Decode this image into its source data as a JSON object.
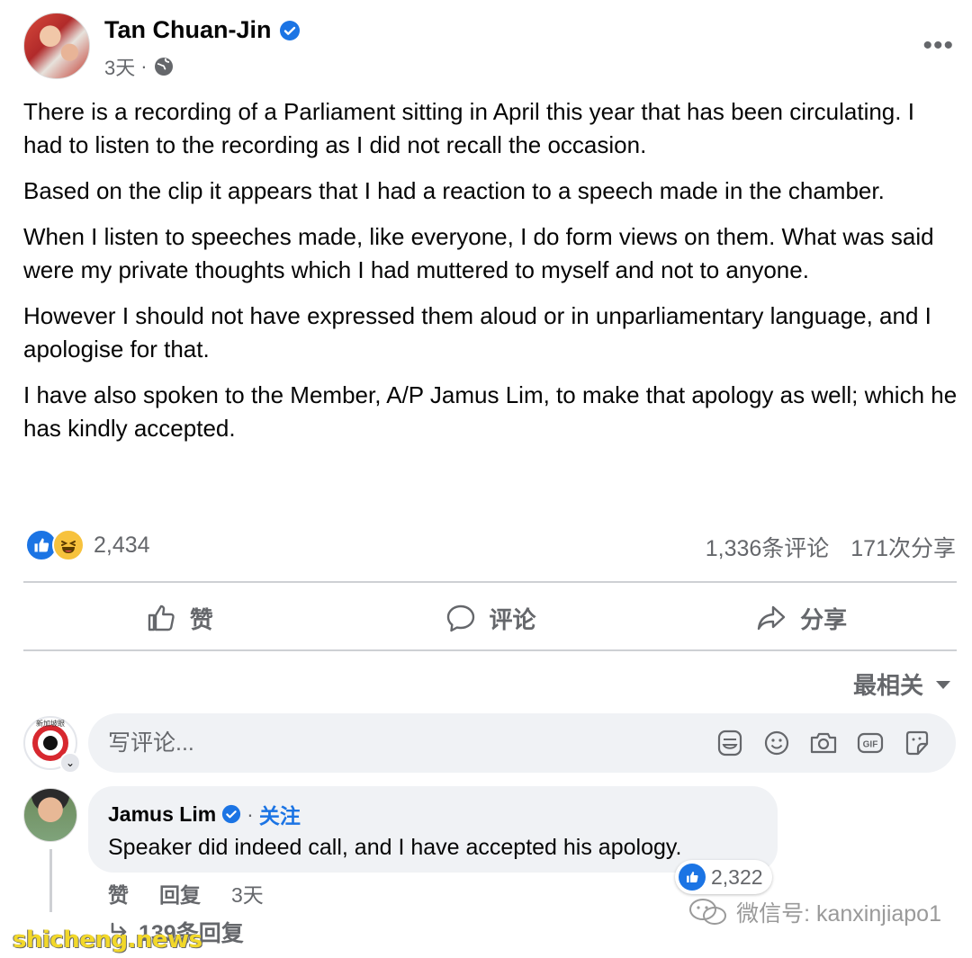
{
  "post": {
    "author": "Tan Chuan-Jin",
    "time": "3天",
    "paragraphs": [
      "There is a recording of a Parliament sitting in April this year that has been circulating. I had to listen to the recording as I did not recall the occasion.",
      "Based on the clip it appears that I had a reaction to a speech made in the chamber.",
      "When I listen to speeches made, like everyone, I do form views on them. What was said were my private thoughts which I had muttered to myself and not to anyone.",
      "However I should not have expressed them aloud or in unparliamentary language, and I apologise for that.",
      "I have also spoken to the Member, A/P Jamus Lim, to make that apology as well; which he has kindly accepted."
    ],
    "reaction_count": "2,434",
    "comments_count": "1,336条评论",
    "shares_count": "171次分享"
  },
  "actions": {
    "like": "赞",
    "comment": "评论",
    "share": "分享"
  },
  "sort_label": "最相关",
  "composer": {
    "placeholder": "写评论...",
    "avatar_brand": "新加坡眼"
  },
  "comment": {
    "author": "Jamus Lim",
    "follow": "关注",
    "text": "Speaker did indeed call, and I have accepted his apology.",
    "reaction_count": "2,322",
    "like": "赞",
    "reply": "回复",
    "time": "3天",
    "replies": "139条回复"
  },
  "wechat_id": "微信号: kanxinjiapo1",
  "watermark": "shicheng.news",
  "colors": {
    "accent": "#1b74e4",
    "secondary_text": "#65676b",
    "bubble_bg": "#f0f2f5"
  }
}
